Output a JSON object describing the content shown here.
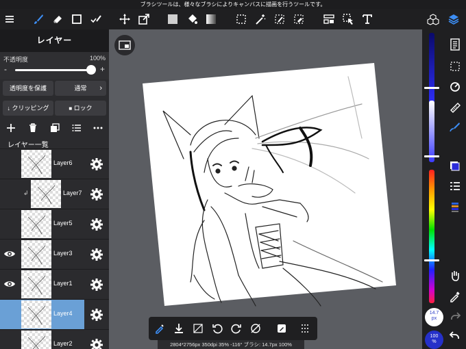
{
  "hint_bar": {
    "text": "ブラシツールは、様々なブラシによりキャンバスに描画を行うツールです。"
  },
  "toolbar": {
    "tools": [
      "menu-icon",
      "brush-icon",
      "eraser-icon",
      "square-icon",
      "select-pen-icon",
      "move-icon",
      "transform-icon",
      "fill-color-icon",
      "bucket-icon",
      "gradient-icon",
      "lasso-select-icon",
      "magic-wand-icon",
      "selection-pen-icon",
      "selection-eraser-icon",
      "filter-icon",
      "select-tool-icon",
      "text-tool-icon",
      "material-icon",
      "layers-icon"
    ],
    "accent_color": "#3d8ef5"
  },
  "layer_panel": {
    "title": "レイヤー",
    "opacity_label": "不透明度",
    "opacity_value": "100%",
    "opacity_level": 1.0,
    "minus": "-",
    "plus": "+",
    "protect_alpha": "透明度を保護",
    "blend_mode": "通常",
    "clipping": "クリッピング",
    "lock": "ロック",
    "list_title": "レイヤー一覧",
    "layers": [
      {
        "name": "Layer6",
        "visible": false,
        "clipped": false,
        "selected": false
      },
      {
        "name": "Layer7",
        "visible": false,
        "clipped": true,
        "selected": false
      },
      {
        "name": "Layer5",
        "visible": false,
        "clipped": false,
        "selected": false
      },
      {
        "name": "Layer3",
        "visible": true,
        "clipped": false,
        "selected": false
      },
      {
        "name": "Layer1",
        "visible": true,
        "clipped": false,
        "selected": false
      },
      {
        "name": "Layer4",
        "visible": false,
        "clipped": false,
        "selected": true
      },
      {
        "name": "Layer2",
        "visible": false,
        "clipped": false,
        "selected": false
      }
    ],
    "selected_color": "#6aa0d6"
  },
  "status_bar": {
    "text": "2804*2756px 350dpi 35% -116° ブラシ: 14.7px 100%"
  },
  "right_panel": {
    "primary_color": "#2b2bd9",
    "brush_size": "14.7",
    "brush_size_unit": "px",
    "brush_opacity": "100",
    "brush_opacity_unit": "%"
  }
}
